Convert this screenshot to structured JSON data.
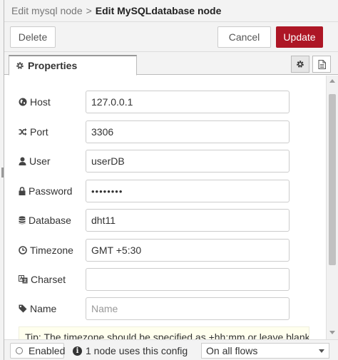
{
  "header": {
    "breadcrumb_prev": "Edit mysql node",
    "separator": ">",
    "title": "Edit MySQLdatabase node"
  },
  "toolbar": {
    "delete_label": "Delete",
    "cancel_label": "Cancel",
    "update_label": "Update"
  },
  "tabs": {
    "properties_label": "Properties",
    "settings_icon": "gear-icon",
    "description_icon": "document-icon"
  },
  "form": {
    "host": {
      "label": "Host",
      "value": "127.0.0.1",
      "icon": "globe-icon"
    },
    "port": {
      "label": "Port",
      "value": "3306",
      "icon": "shuffle-icon"
    },
    "user": {
      "label": "User",
      "value": "userDB",
      "icon": "user-icon"
    },
    "password": {
      "label": "Password",
      "value": "••••••••",
      "icon": "lock-icon"
    },
    "database": {
      "label": "Database",
      "value": "dht11",
      "icon": "database-icon"
    },
    "timezone": {
      "label": "Timezone",
      "value": "GMT +5:30",
      "icon": "clock-icon"
    },
    "charset": {
      "label": "Charset",
      "value": "",
      "icon": "language-icon"
    },
    "name": {
      "label": "Name",
      "value": "",
      "placeholder": "Name",
      "icon": "tag-icon"
    }
  },
  "tip": {
    "text": "Tip: The timezone should be specified as +hh:mm or leave blank for"
  },
  "footer": {
    "enabled_label": "Enabled",
    "usage_text": "1 node uses this config",
    "scope_value": "On all flows"
  },
  "colors": {
    "accent": "#ad1625",
    "panel_bg": "#f3f3f3",
    "border": "#cccccc"
  }
}
